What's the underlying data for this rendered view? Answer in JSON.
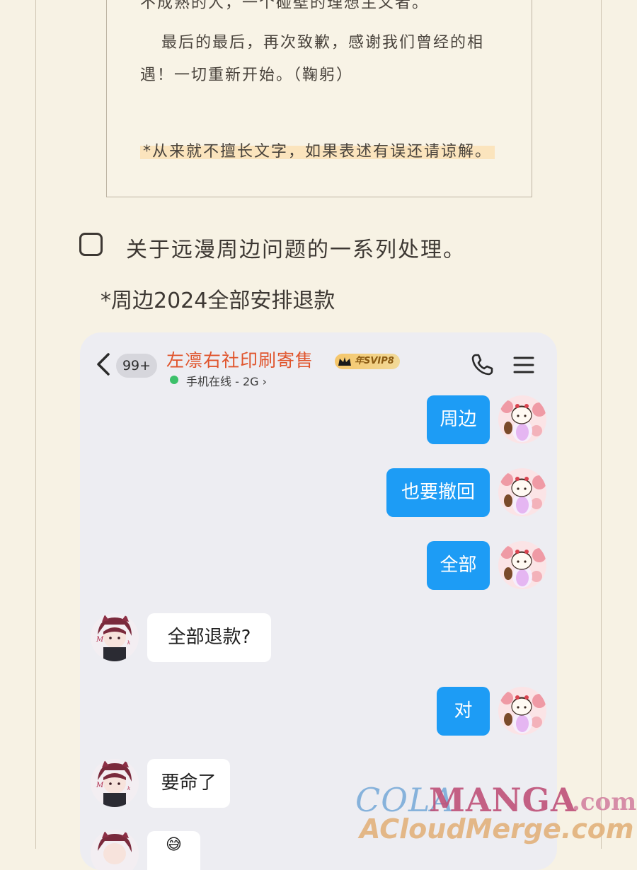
{
  "letter": {
    "lines": [
      "不成熟的人，一个碰壁的理想主义者。",
      "最后的最后，再次致歉，感谢我们曾经的相",
      "遇！一切重新开始。（鞠躬）",
      "*从来就不擅长文字，如果表述有误还请谅解。"
    ]
  },
  "checklist": {
    "item_label": "关于远漫周边问题的一系列处理。",
    "note": "*周边2024全部安排退款"
  },
  "chat": {
    "unread_count": "99+",
    "title": "左凛右社印刷寄售",
    "svip_badge": "年SVIP8",
    "status": "手机在线 - 2G ›",
    "messages": [
      {
        "side": "out",
        "text": "周边"
      },
      {
        "side": "out",
        "text": "也要撤回"
      },
      {
        "side": "out",
        "text": "全部"
      },
      {
        "side": "in",
        "text": "全部退款?"
      },
      {
        "side": "out",
        "text": "对"
      },
      {
        "side": "in",
        "text": "要命了"
      },
      {
        "side": "in",
        "text": "😅"
      }
    ],
    "icons": {
      "back": "back-chevron-icon",
      "call": "phone-icon",
      "menu": "menu-icon"
    },
    "colors": {
      "outgoing_bubble": "#1d9cf5",
      "incoming_bubble": "#ffffff",
      "title": "#e0542c",
      "online": "#3cc06a"
    }
  },
  "watermark": {
    "cola": "COLA",
    "manga": "MANGA",
    "com": ".com",
    "acloud": "ACloudMerge.com"
  }
}
